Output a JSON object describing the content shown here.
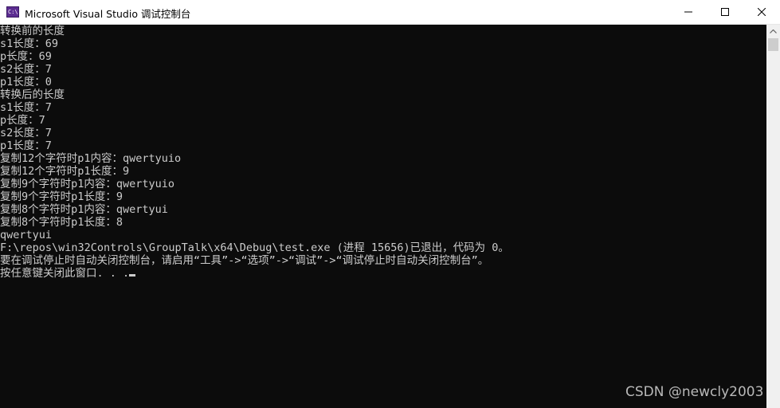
{
  "window": {
    "title": "Microsoft Visual Studio 调试控制台",
    "icon": "console-app-icon"
  },
  "controls": {
    "minimize": "minimize-icon",
    "maximize": "maximize-icon",
    "close": "close-icon"
  },
  "console": {
    "lines": [
      "转换前的长度",
      "s1长度：69",
      "p长度：69",
      "s2长度：7",
      "p1长度：0",
      "转换后的长度",
      "s1长度：7",
      "p长度：7",
      "s2长度：7",
      "p1长度：7",
      "复制12个字符时p1内容：qwertyuio",
      "复制12个字符时p1长度：9",
      "复制9个字符时p1内容：qwertyuio",
      "复制9个字符时p1长度：9",
      "复制8个字符时p1内容：qwertyui",
      "复制8个字符时p1长度：8",
      "qwertyui",
      "F:\\repos\\win32Controls\\GroupTalk\\x64\\Debug\\test.exe (进程 15656)已退出，代码为 0。",
      "要在调试停止时自动关闭控制台，请启用“工具”->“选项”->“调试”->“调试停止时自动关闭控制台”。",
      "按任意键关闭此窗口. . ."
    ]
  },
  "watermark": "CSDN @newcly2003",
  "colors": {
    "console_bg": "#0c0c0c",
    "console_text": "#cccccc",
    "titlebar_bg": "#ffffff"
  }
}
